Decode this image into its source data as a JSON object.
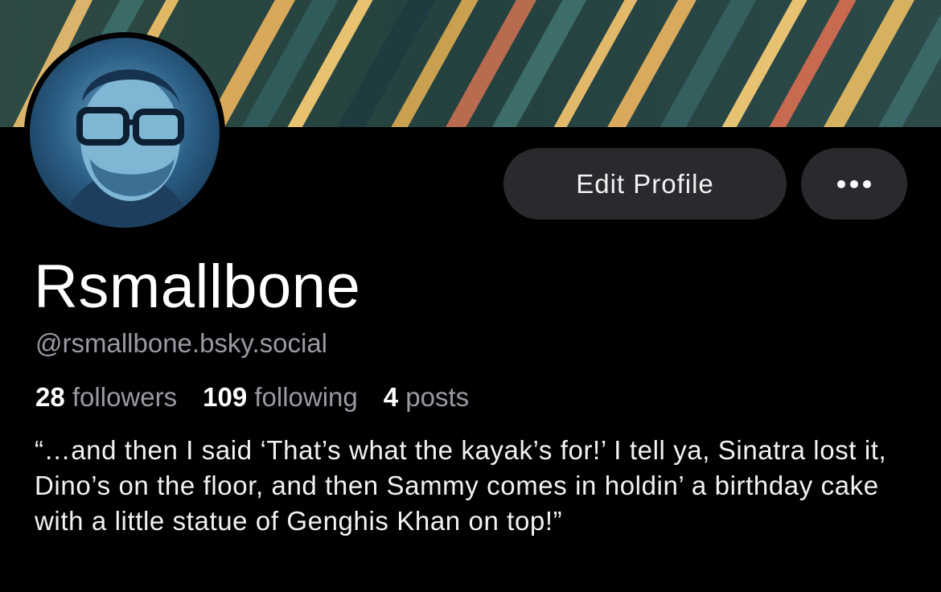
{
  "profile": {
    "display_name": "Rsmallbone",
    "handle": "@rsmallbone.bsky.social",
    "bio": "“…and then I said ‘That’s what the kayak’s for!’ I tell ya, Sinatra lost it, Dino’s on the floor, and then Sammy comes in holdin’ a birthday cake with a little statue of Genghis Khan on top!”"
  },
  "stats": {
    "followers_count": "28",
    "followers_label": "followers",
    "following_count": "109",
    "following_label": "following",
    "posts_count": "4",
    "posts_label": "posts"
  },
  "actions": {
    "edit_profile_label": "Edit Profile",
    "more_icon": "ellipsis-icon"
  },
  "colors": {
    "background": "#000000",
    "button_bg": "#2a2a2e",
    "secondary_text": "#9a9aa3"
  }
}
